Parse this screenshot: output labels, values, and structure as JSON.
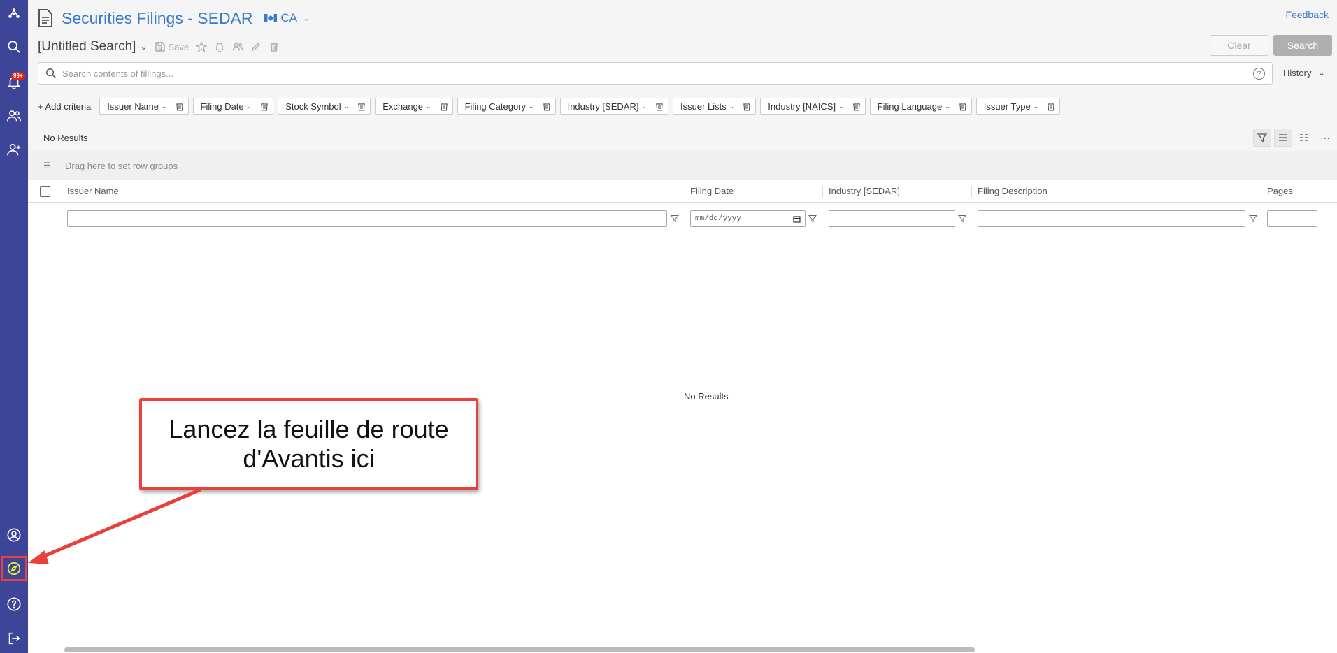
{
  "header": {
    "title": "Securities Filings - SEDAR",
    "country": "CA",
    "feedback": "Feedback"
  },
  "search": {
    "name": "[Untitled Search]",
    "save_label": "Save",
    "clear_label": "Clear",
    "search_label": "Search",
    "placeholder": "Search contents of fillings...",
    "help": "?",
    "history_label": "History"
  },
  "criteria": {
    "add_label": "+ Add criteria",
    "chips": [
      "Issuer Name",
      "Filing Date",
      "Stock Symbol",
      "Exchange",
      "Filing Category",
      "Industry [SEDAR]",
      "Issuer Lists",
      "Industry [NAICS]",
      "Filing Language",
      "Issuer Type"
    ]
  },
  "grid": {
    "results_label": "No Results",
    "group_hint": "Drag here to set row groups",
    "columns": [
      "Issuer Name",
      "Filing Date",
      "Industry [SEDAR]",
      "Filing Description",
      "Pages"
    ],
    "date_placeholder": "mm/dd/yyyy",
    "empty_message": "No Results",
    "more": "···"
  },
  "sidebar": {
    "notification_badge": "99+"
  },
  "callout": {
    "text": "Lancez la feuille de route d'Avantis ici"
  },
  "colors": {
    "sidebar": "#3d4599",
    "accent": "#3a7bc8",
    "callout_border": "#e8413b",
    "badge": "#e2231a"
  }
}
